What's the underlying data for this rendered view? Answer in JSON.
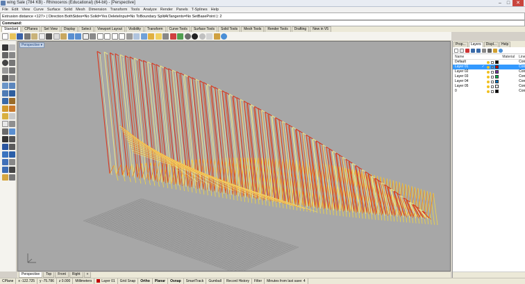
{
  "window": {
    "title": "wing Sale (784 KB) - Rhinoceros (Educational) (64-bit) - [Perspective]",
    "controls": [
      "–",
      "□",
      "✕"
    ]
  },
  "menu": [
    "File",
    "Edit",
    "View",
    "Curve",
    "Surface",
    "Solid",
    "Mesh",
    "Dimension",
    "Transform",
    "Tools",
    "Analyze",
    "Render",
    "Panels",
    "T-Splines",
    "Help"
  ],
  "command": {
    "history": "Extrusion distance <127> ( Direction BothSides=No Solid=Yes DeleteInput=No ToBoundary SplitAtTangents=No SetBasePoint ): 2",
    "prompt_label": "Command:"
  },
  "toolbar_tabs": [
    "Standard",
    "CPlanes",
    "Set View",
    "Display",
    "Select",
    "Viewport Layout",
    "Visibility",
    "Transform",
    "Curve Tools",
    "Surface Tools",
    "Solid Tools",
    "Mesh Tools",
    "Render Tools",
    "Drafting",
    "New in V5"
  ],
  "viewport": {
    "label": "Perspective"
  },
  "view_tabs": [
    "Perspective",
    "Top",
    "Front",
    "Right",
    "+"
  ],
  "panel": {
    "tabs": [
      "Prop...",
      "Layers",
      "Displ...",
      "Help"
    ],
    "columns": {
      "name": "Name",
      "material": "Material",
      "linetype": "Linety..."
    },
    "layers": [
      {
        "name": "Default",
        "color": "#000000",
        "linetype": "Contin",
        "current": false,
        "selected": false
      },
      {
        "name": "Layer 01",
        "color": "#c00000",
        "linetype": "Contin",
        "current": true,
        "selected": true
      },
      {
        "name": "Layer 02",
        "color": "#7030a0",
        "linetype": "Contin",
        "current": false,
        "selected": false
      },
      {
        "name": "Layer 03",
        "color": "#00b050",
        "linetype": "Contin",
        "current": false,
        "selected": false
      },
      {
        "name": "Layer 04",
        "color": "#0070c0",
        "linetype": "Contin",
        "current": false,
        "selected": false
      },
      {
        "name": "Layer 05",
        "color": "#ffffff",
        "linetype": "Contin",
        "current": false,
        "selected": false
      },
      {
        "name": "0",
        "color": "#000000",
        "linetype": "Contin",
        "current": false,
        "selected": false
      }
    ]
  },
  "status": {
    "cplane": "CPlane",
    "x": "x -122.725",
    "y": "y -75.786",
    "z": "z 0.000",
    "units": "Millimeters",
    "layer": "Layer 01",
    "layer_color": "#c00000",
    "toggles": [
      "Grid Snap",
      "Ortho",
      "Planar",
      "Osnap",
      "SmartTrack",
      "Gumball",
      "Record History",
      "Filter"
    ],
    "autosave": "Minutes from last save: 4"
  }
}
